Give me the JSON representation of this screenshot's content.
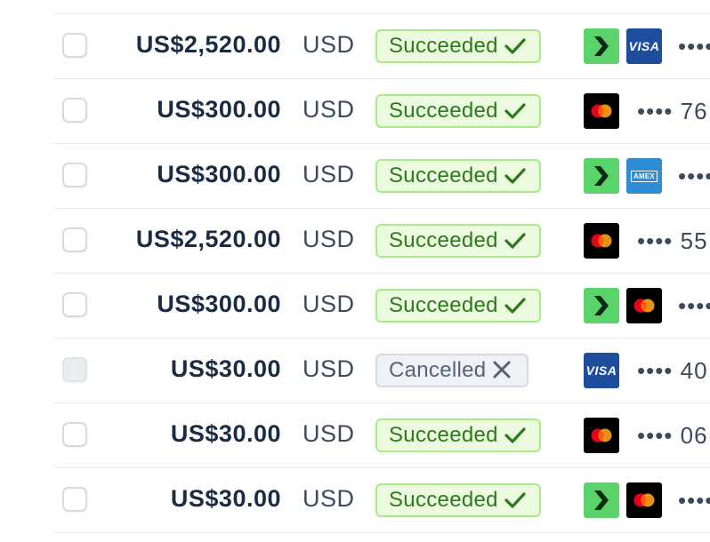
{
  "payments": [
    {
      "amount": "US$2,520.00",
      "currency": "USD",
      "status": "Succeeded",
      "status_type": "success",
      "logos": [
        "link-icon",
        "visa-icon"
      ],
      "card": "••••"
    },
    {
      "amount": "US$300.00",
      "currency": "USD",
      "status": "Succeeded",
      "status_type": "success",
      "logos": [
        "mastercard-icon"
      ],
      "card": "•••• 76"
    },
    {
      "amount": "US$300.00",
      "currency": "USD",
      "status": "Succeeded",
      "status_type": "success",
      "logos": [
        "link-icon",
        "amex-icon"
      ],
      "card": "••••"
    },
    {
      "amount": "US$2,520.00",
      "currency": "USD",
      "status": "Succeeded",
      "status_type": "success",
      "logos": [
        "mastercard-icon"
      ],
      "card": "•••• 55"
    },
    {
      "amount": "US$300.00",
      "currency": "USD",
      "status": "Succeeded",
      "status_type": "success",
      "logos": [
        "link-icon",
        "mastercard-icon"
      ],
      "card": "••••"
    },
    {
      "amount": "US$30.00",
      "currency": "USD",
      "status": "Cancelled",
      "status_type": "cancelled",
      "logos": [
        "visa-icon"
      ],
      "card": "•••• 40"
    },
    {
      "amount": "US$30.00",
      "currency": "USD",
      "status": "Succeeded",
      "status_type": "success",
      "logos": [
        "mastercard-icon"
      ],
      "card": "•••• 06"
    },
    {
      "amount": "US$30.00",
      "currency": "USD",
      "status": "Succeeded",
      "status_type": "success",
      "logos": [
        "link-icon",
        "mastercard-icon"
      ],
      "card": "••••"
    }
  ],
  "brand_text": {
    "visa": "VISA",
    "amex": "AMEX"
  },
  "colors": {
    "success_bg": "#ecfbdf",
    "success_border": "#a8ec86",
    "success_text": "#2d7a1c",
    "cancel_bg": "#eef2f7",
    "cancel_text": "#56637a",
    "link_green": "#5ad36b",
    "visa_blue": "#1f4d9e",
    "amex_blue": "#2f8ed3",
    "mc_red": "#eb001b",
    "mc_orange": "#f79e1b"
  }
}
